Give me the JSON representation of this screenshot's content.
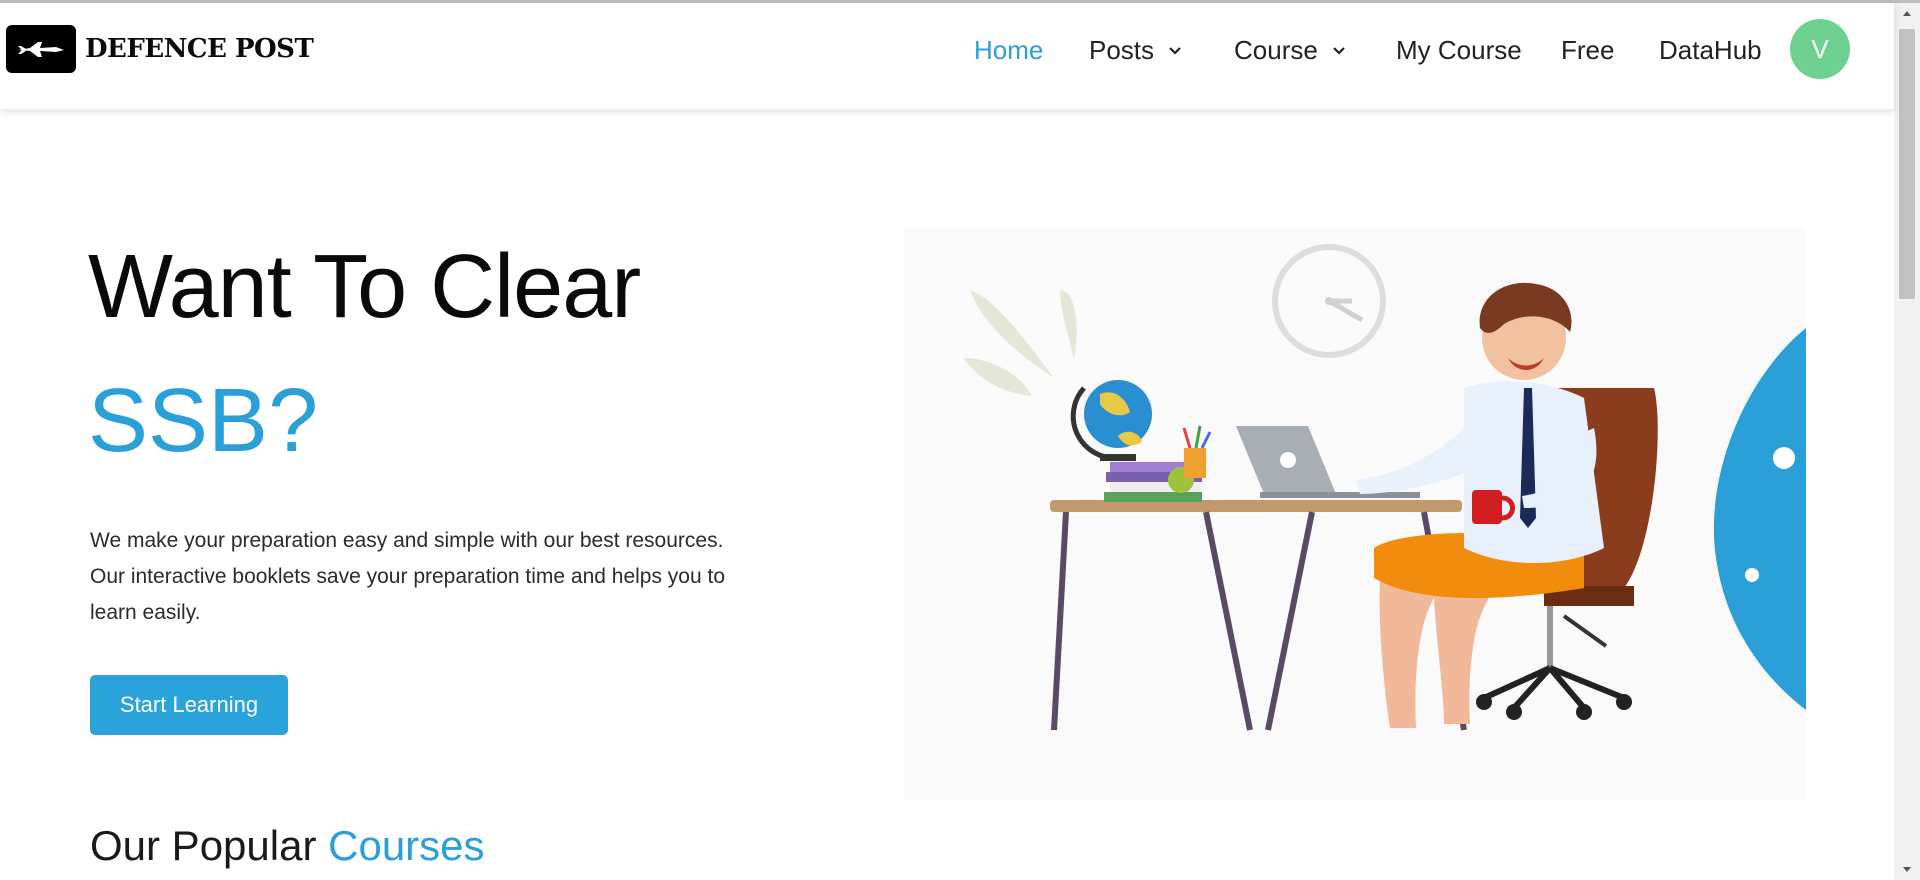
{
  "brand": {
    "name": "DEFENCE POST",
    "logo_icon": "fighter-jet-icon"
  },
  "nav": {
    "items": [
      {
        "label": "Home",
        "active": true,
        "dropdown": false
      },
      {
        "label": "Posts",
        "active": false,
        "dropdown": true
      },
      {
        "label": "Course",
        "active": false,
        "dropdown": true
      },
      {
        "label": "My Course",
        "active": false,
        "dropdown": false
      },
      {
        "label": "Free",
        "active": false,
        "dropdown": false
      },
      {
        "label": "DataHub",
        "active": false,
        "dropdown": false
      }
    ],
    "avatar_initial": "V"
  },
  "hero": {
    "title": "Want To Clear",
    "title_accent": "SSB?",
    "description": "We make your preparation easy and simple with our best resources. Our interactive booklets save your preparation time and helps you to learn easily.",
    "cta_label": "Start Learning"
  },
  "section": {
    "title_prefix": "Our Popular",
    "title_highlight": "Courses"
  },
  "colors": {
    "accent": "#2a9fd8",
    "button": "#2aa3db",
    "avatar": "#6fd190",
    "text": "#1a1a1a"
  }
}
